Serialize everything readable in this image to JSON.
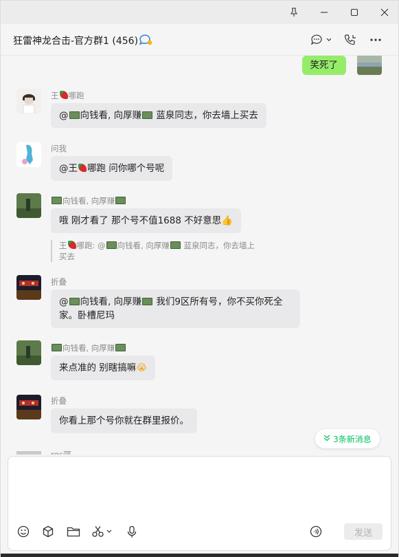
{
  "window": {
    "pin_icon": "pin-icon",
    "minimize_icon": "minimize-icon",
    "maximize_icon": "maximize-icon",
    "close_icon": "close-icon"
  },
  "header": {
    "title": "狂雷神龙合击-官方群1 (456)",
    "group_icon": "group-chat-icon",
    "chat_icon": "chat-bubble-icon",
    "call_icon": "phone-call-icon",
    "more_icon": "more-icon"
  },
  "messages": {
    "mine": {
      "text": "笑死了"
    },
    "m1": {
      "sender_a": "王",
      "sender_b": "哪跑",
      "text_a": "@",
      "text_b": "向钱看, 向厚赚",
      "text_c": " 蓝泉同志，你去墙上买去"
    },
    "m2": {
      "sender": "问我",
      "text_a": "@王",
      "text_b": "哪跑 问你哪个号呢"
    },
    "m3": {
      "sender": "向钱看, 向厚赚",
      "text": "哦 刚才看了 那个号不值1688 不好意思",
      "quote_a": "王",
      "quote_b": "哪跑: @",
      "quote_c": "向钱看, 向厚赚",
      "quote_d": " 蓝泉同志，你去墙上买去"
    },
    "m4": {
      "sender": "折叠",
      "text_a": "@",
      "text_b": "向钱看, 向厚赚",
      "text_c": " 我们9区所有号，你不买你死全家。卧槽尼玛"
    },
    "m5": {
      "sender": "向钱看, 向厚赚",
      "text": "来点准的 别瞎搞嘛"
    },
    "m6": {
      "sender": "折叠",
      "text": "你看上那个号你就在群里报价。"
    },
    "m7": {
      "sender": "rgc邵"
    }
  },
  "new_messages": {
    "label": "3条新消息",
    "icon": "double-chevron-down-icon"
  },
  "composer": {
    "emoji_icon": "emoji-icon",
    "box_icon": "cube-icon",
    "folder_icon": "folder-icon",
    "scissors_icon": "scissors-icon",
    "mic_icon": "microphone-icon",
    "voice_icon": "voice-message-icon",
    "send_label": "发送"
  },
  "colors": {
    "my_bubble": "#95ec69",
    "other_bubble": "#e9e9eb",
    "accent_green": "#07c160"
  }
}
